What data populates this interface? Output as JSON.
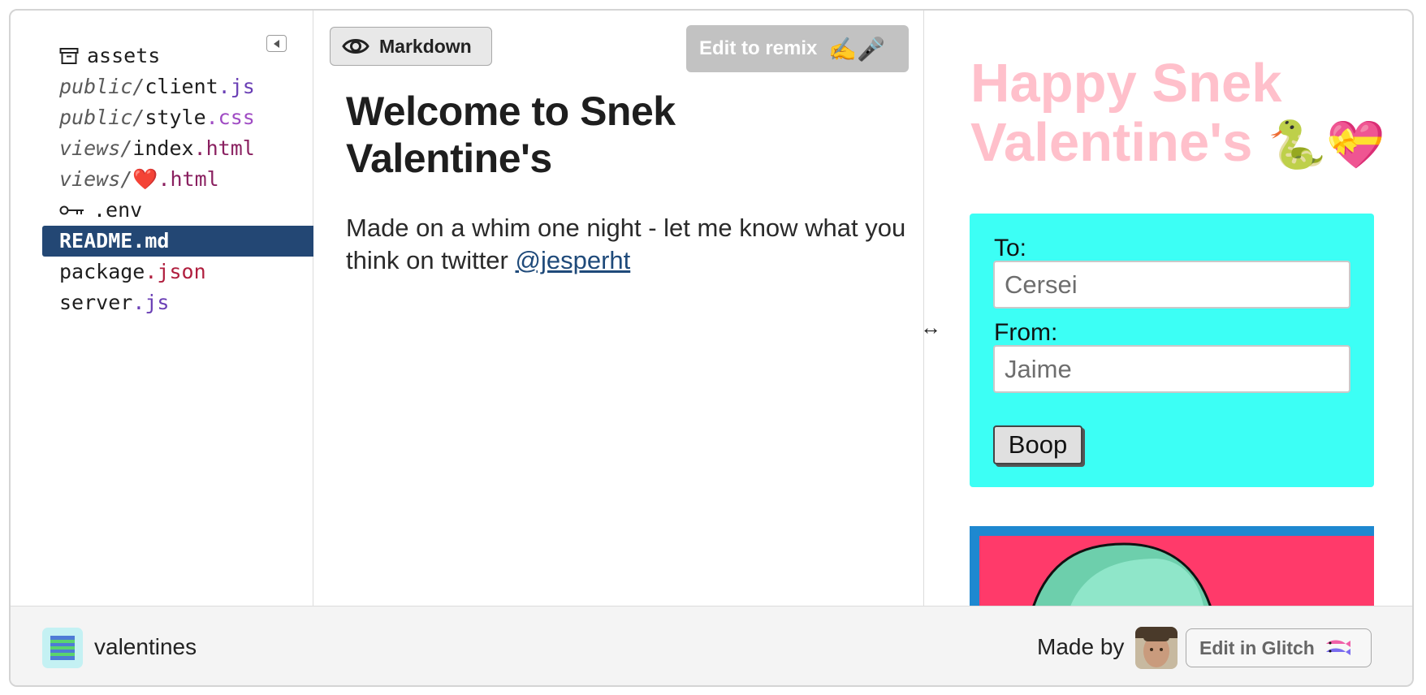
{
  "sidebar": {
    "files": [
      {
        "icon": "archive-icon",
        "dir": "",
        "name": "assets",
        "ext": "",
        "ext_color": "#1e1e1e"
      },
      {
        "icon": "",
        "dir": "public/",
        "name": "client",
        "ext": ".js",
        "ext_color": "#6a3fb5"
      },
      {
        "icon": "",
        "dir": "public/",
        "name": "style",
        "ext": ".css",
        "ext_color": "#a04cc4"
      },
      {
        "icon": "",
        "dir": "views/",
        "name": "index",
        "ext": ".html",
        "ext_color": "#8a2060"
      },
      {
        "icon": "",
        "dir": "views/",
        "name": "❤️",
        "ext": ".html",
        "ext_color": "#8a2060"
      },
      {
        "icon": "key-icon",
        "dir": "",
        "name": "",
        "ext": ".env",
        "ext_color": "#1e1e1e"
      },
      {
        "icon": "",
        "dir": "",
        "name": "README",
        "ext": ".md",
        "ext_color": "#ffffff"
      },
      {
        "icon": "",
        "dir": "",
        "name": "package",
        "ext": ".json",
        "ext_color": "#b01e3e"
      },
      {
        "icon": "",
        "dir": "",
        "name": "server",
        "ext": ".js",
        "ext_color": "#6a3fb5"
      }
    ],
    "active_index": 6
  },
  "editor": {
    "markdown_label": "Markdown",
    "remix_label": "Edit to remix",
    "remix_emoji": "✍️🎤",
    "title": "Welcome to Snek Valentine's",
    "paragraph_text": "Made on a whim one night - let me know what you think on twitter ",
    "paragraph_link": "@jesperht",
    "resize_glyph": "↔"
  },
  "preview": {
    "title": "Happy Snek Valentine's",
    "title_emoji": "🐍💝",
    "title_color": "#ffc0cb",
    "form_bg": "#3cfff5",
    "to_label": "To:",
    "to_value": "Cersei",
    "from_label": "From:",
    "from_value": "Jaime",
    "button_label": "Boop"
  },
  "footer": {
    "project_name": "valentines",
    "made_by_label": "Made by",
    "edit_button_label": "Edit in Glitch"
  },
  "colors": {
    "active_file_bg": "#234774",
    "link": "#1f4a7a",
    "remix_bg": "#c2c2c2"
  }
}
